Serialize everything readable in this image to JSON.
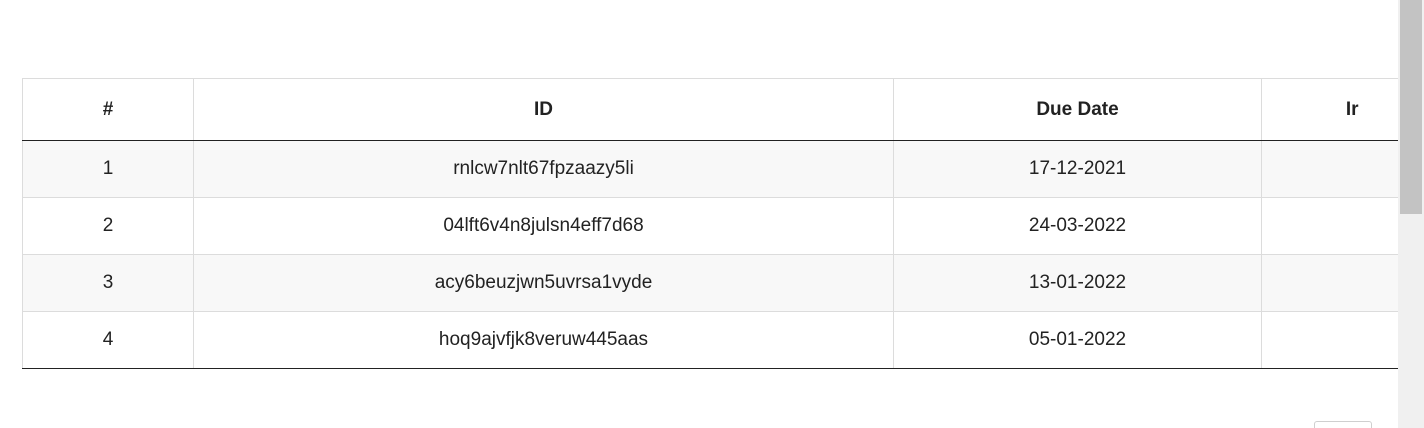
{
  "table": {
    "headers": {
      "num": "#",
      "id": "ID",
      "due_date": "Due Date",
      "next": "Ir"
    },
    "rows": [
      {
        "num": "1",
        "id": "rnlcw7nlt67fpzaazy5li",
        "due_date": "17-12-2021"
      },
      {
        "num": "2",
        "id": "04lft6v4n8julsn4eff7d68",
        "due_date": "24-03-2022"
      },
      {
        "num": "3",
        "id": "acy6beuzjwn5uvrsa1vyde",
        "due_date": "13-01-2022"
      },
      {
        "num": "4",
        "id": "hoq9ajvfjk8veruw445aas",
        "due_date": "05-01-2022"
      }
    ]
  },
  "colors": {
    "header_rule": "#222222",
    "stripe": "#f8f8f8",
    "grid": "#dcdcdc",
    "scrollbar_track": "#f0f0f0",
    "scrollbar_thumb": "#c3c3c3"
  }
}
